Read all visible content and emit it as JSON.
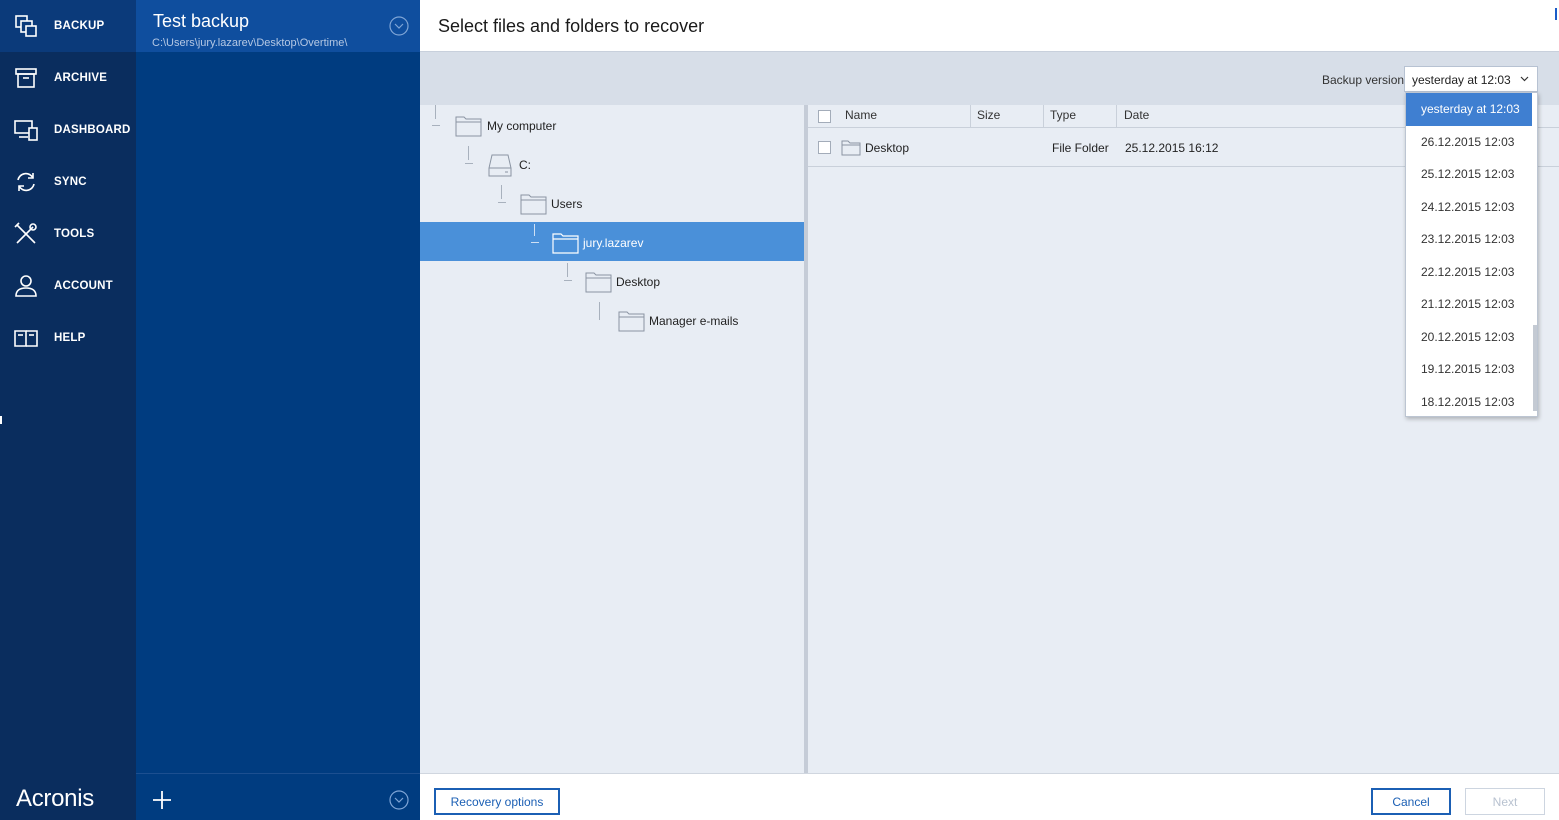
{
  "nav": {
    "items": [
      {
        "label": "BACKUP",
        "icon": "backup-icon"
      },
      {
        "label": "ARCHIVE",
        "icon": "archive-icon"
      },
      {
        "label": "DASHBOARD",
        "icon": "dashboard-icon"
      },
      {
        "label": "SYNC",
        "icon": "sync-icon"
      },
      {
        "label": "TOOLS",
        "icon": "tools-icon"
      },
      {
        "label": "ACCOUNT",
        "icon": "account-icon"
      },
      {
        "label": "HELP",
        "icon": "help-icon"
      }
    ],
    "logo": "Acronis"
  },
  "backup_list": {
    "selected": {
      "title": "Test backup",
      "path": "C:\\Users\\jury.lazarev\\Desktop\\Overtime\\"
    }
  },
  "main": {
    "title": "Select files and folders to recover",
    "backup_version": {
      "label": "Backup version:",
      "value": "yesterday at 12:03",
      "options": [
        "yesterday at 12:03",
        "26.12.2015 12:03",
        "25.12.2015 12:03",
        "24.12.2015 12:03",
        "23.12.2015 12:03",
        "22.12.2015 12:03",
        "21.12.2015 12:03",
        "20.12.2015 12:03",
        "19.12.2015 12:03",
        "18.12.2015 12:03"
      ]
    },
    "tree": [
      {
        "label": "My computer",
        "icon": "folder-icon"
      },
      {
        "label": "C:",
        "icon": "drive-icon"
      },
      {
        "label": "Users",
        "icon": "folder-icon"
      },
      {
        "label": "jury.lazarev",
        "icon": "folder-icon",
        "selected": true
      },
      {
        "label": "Desktop",
        "icon": "folder-icon"
      },
      {
        "label": "Manager e-mails",
        "icon": "folder-icon"
      }
    ],
    "file_table": {
      "columns": [
        "Name",
        "Size",
        "Type",
        "Date"
      ],
      "rows": [
        {
          "name": "Desktop",
          "size": "",
          "type": "File Folder",
          "date": "25.12.2015 16:12"
        }
      ]
    },
    "footer": {
      "recovery_options": "Recovery options",
      "cancel": "Cancel",
      "next": "Next"
    }
  },
  "colors": {
    "nav_bg": "#0a2d5e",
    "list_bg": "#003c80",
    "accent": "#1b5fb4",
    "selection": "#4a90d9"
  }
}
